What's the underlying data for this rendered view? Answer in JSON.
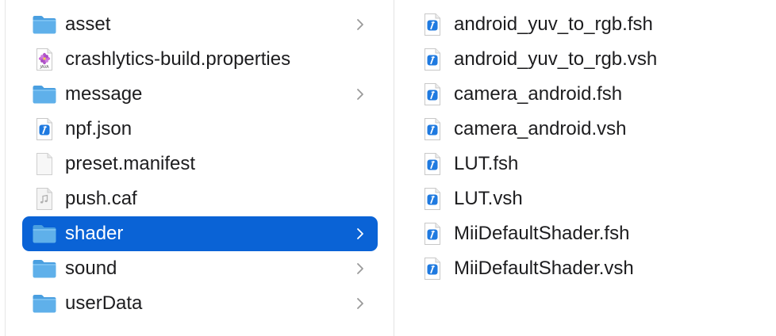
{
  "columns": [
    {
      "items": [
        {
          "label": "asset",
          "icon": "folder-icon",
          "has_children": true,
          "selected": false
        },
        {
          "label": "crashlytics-build.properties",
          "icon": "java-properties-icon",
          "has_children": false,
          "selected": false
        },
        {
          "label": "message",
          "icon": "folder-icon",
          "has_children": true,
          "selected": false
        },
        {
          "label": "npf.json",
          "icon": "xcode-source-file-icon",
          "has_children": false,
          "selected": false
        },
        {
          "label": "preset.manifest",
          "icon": "blank-document-icon",
          "has_children": false,
          "selected": false
        },
        {
          "label": "push.caf",
          "icon": "audio-file-icon",
          "has_children": false,
          "selected": false
        },
        {
          "label": "shader",
          "icon": "folder-icon",
          "has_children": true,
          "selected": true
        },
        {
          "label": "sound",
          "icon": "folder-icon",
          "has_children": true,
          "selected": false
        },
        {
          "label": "userData",
          "icon": "folder-icon",
          "has_children": true,
          "selected": false
        }
      ]
    },
    {
      "items": [
        {
          "label": "android_yuv_to_rgb.fsh",
          "icon": "xcode-source-file-icon"
        },
        {
          "label": "android_yuv_to_rgb.vsh",
          "icon": "xcode-source-file-icon"
        },
        {
          "label": "camera_android.fsh",
          "icon": "xcode-source-file-icon"
        },
        {
          "label": "camera_android.vsh",
          "icon": "xcode-source-file-icon"
        },
        {
          "label": "LUT.fsh",
          "icon": "xcode-source-file-icon"
        },
        {
          "label": "LUT.vsh",
          "icon": "xcode-source-file-icon"
        },
        {
          "label": "MiiDefaultShader.fsh",
          "icon": "xcode-source-file-icon"
        },
        {
          "label": "MiiDefaultShader.vsh",
          "icon": "xcode-source-file-icon"
        }
      ]
    }
  ],
  "colors": {
    "selection": "#0a63d6",
    "folder": "#5fb0ea",
    "folder_tab": "#4a9fe0",
    "xcode_badge": "#1f7ae0",
    "chevron": "#9a9a9a",
    "text": "#1d1d1f"
  }
}
